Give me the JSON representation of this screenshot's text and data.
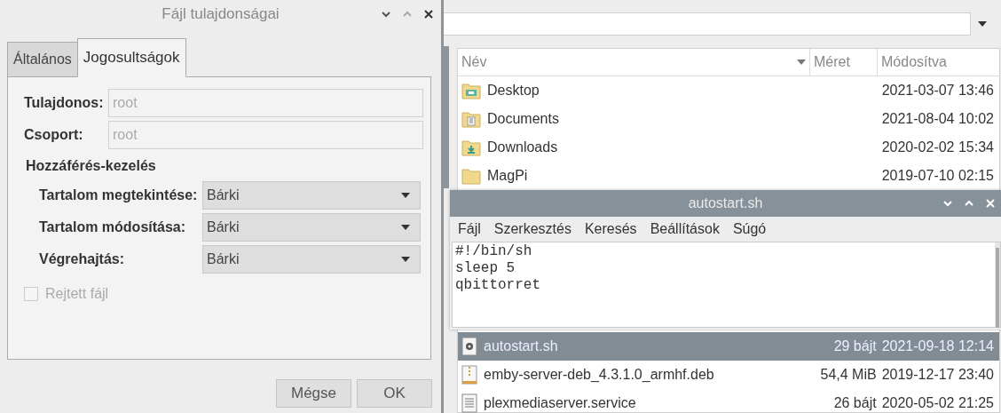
{
  "file_manager": {
    "columns": [
      {
        "label": "Név",
        "sorted": true
      },
      {
        "label": "Méret",
        "sorted": false
      },
      {
        "label": "Módosítva",
        "sorted": false
      }
    ],
    "rows": [
      {
        "name": "Desktop",
        "kind": "desktop",
        "size": "",
        "modified": "2021-03-07 13:46",
        "selected": false
      },
      {
        "name": "Documents",
        "kind": "documents",
        "size": "",
        "modified": "2021-08-04 10:02",
        "selected": false
      },
      {
        "name": "Downloads",
        "kind": "downloads",
        "size": "",
        "modified": "2020-02-02 15:34",
        "selected": false
      },
      {
        "name": "MagPi",
        "kind": "folder",
        "size": "",
        "modified": "2019-07-10 02:15",
        "selected": false
      },
      {
        "name": "autostart.sh",
        "kind": "script",
        "size": "29 bájt",
        "modified": "2021-09-18 12:14",
        "selected": true
      },
      {
        "name": "emby-server-deb_4.3.1.0_armhf.deb",
        "kind": "archive",
        "size": "54,4 MiB",
        "modified": "2019-12-17 23:40",
        "selected": false
      },
      {
        "name": "plexmediaserver.service",
        "kind": "text",
        "size": "26 bájt",
        "modified": "2020-05-02 21:25",
        "selected": false
      }
    ]
  },
  "editor": {
    "title": "autostart.sh",
    "menu": [
      "Fájl",
      "Szerkesztés",
      "Keresés",
      "Beállítások",
      "Súgó"
    ],
    "lines": [
      "#!/bin/sh",
      "sleep 5",
      "qbittorret"
    ]
  },
  "dialog": {
    "title": "Fájl tulajdonságai",
    "tabs": [
      {
        "label": "Általános",
        "selected": false
      },
      {
        "label": "Jogosultságok",
        "selected": true
      }
    ],
    "owner": {
      "label": "Tulajdonos:",
      "value": "root",
      "disabled": true
    },
    "group": {
      "label": "Csoport:",
      "value": "root",
      "disabled": true
    },
    "access_heading": "Hozzáférés-kezelés",
    "access": [
      {
        "label": "Tartalom megtekintése:",
        "value": "Bárki"
      },
      {
        "label": "Tartalom módosítása:",
        "value": "Bárki"
      },
      {
        "label": "Végrehajtás:",
        "value": "Bárki"
      }
    ],
    "hidden_file": {
      "label": "Rejtett fájl",
      "checked": false,
      "disabled": true
    },
    "buttons": [
      "Mégse",
      "OK"
    ]
  }
}
